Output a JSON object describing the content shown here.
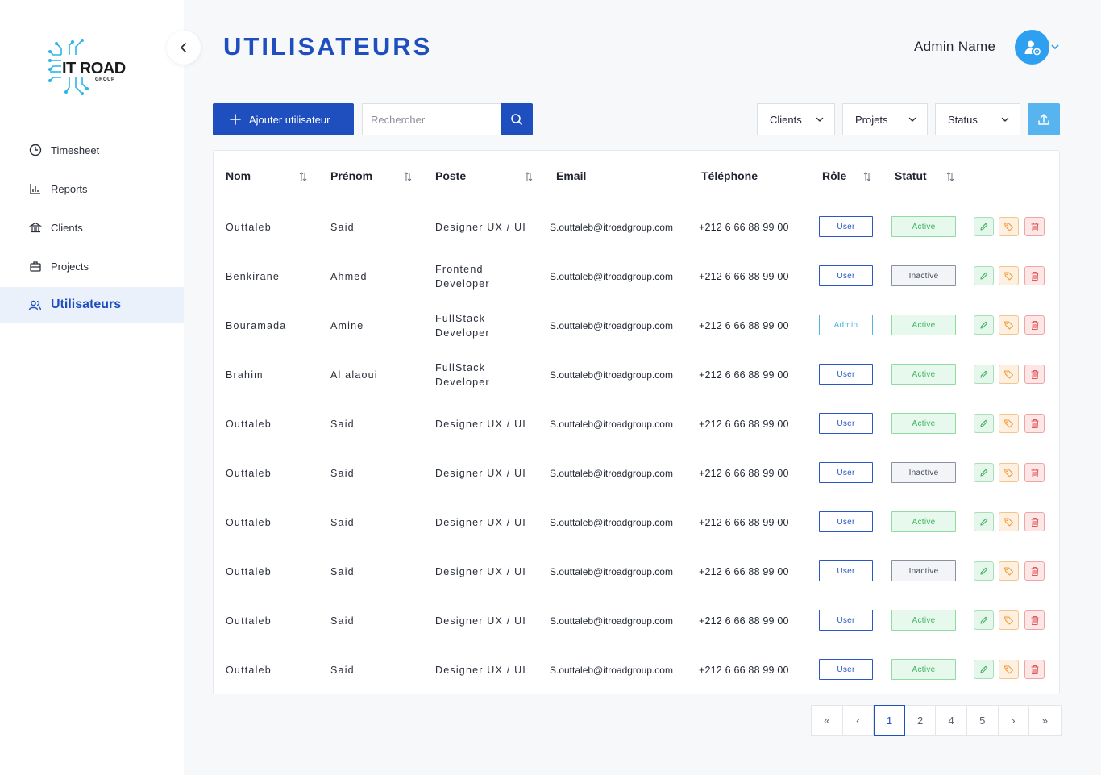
{
  "sidebar": {
    "logo": {
      "text": "IT ROAD",
      "sub": "GROUP"
    },
    "items": [
      {
        "label": "Timesheet",
        "icon": "clock-icon"
      },
      {
        "label": "Reports",
        "icon": "bar-chart-icon"
      },
      {
        "label": "Clients",
        "icon": "bank-icon"
      },
      {
        "label": "Projects",
        "icon": "briefcase-icon"
      },
      {
        "label": "Utilisateurs",
        "icon": "users-icon",
        "active": true
      }
    ]
  },
  "header": {
    "title": "UTILISATEURS",
    "admin_name": "Admin Name"
  },
  "toolbar": {
    "add_label": "Ajouter utilisateur",
    "search_placeholder": "Rechercher",
    "filters": [
      "Clients",
      "Projets",
      "Status"
    ]
  },
  "table": {
    "columns": {
      "nom": "Nom",
      "prenom": "Prénom",
      "poste": "Poste",
      "email": "Email",
      "telephone": "Téléphone",
      "role": "Rôle",
      "statut": "Statut"
    },
    "rows": [
      {
        "nom": "Outtaleb",
        "prenom": "Said",
        "poste": [
          "Designer UX / UI"
        ],
        "email": "S.outtaleb@itroadgroup.com",
        "tel": "+212 6 66 88 99 00",
        "role": "User",
        "statut": "Active"
      },
      {
        "nom": "Benkirane",
        "prenom": "Ahmed",
        "poste": [
          "Frontend",
          "Developer"
        ],
        "email": "S.outtaleb@itroadgroup.com",
        "tel": "+212 6 66 88 99 00",
        "role": "User",
        "statut": "Inactive"
      },
      {
        "nom": "Bouramada",
        "prenom": "Amine",
        "poste": [
          "FullStack",
          "Developer"
        ],
        "email": "S.outtaleb@itroadgroup.com",
        "tel": "+212 6 66 88 99 00",
        "role": "Admin",
        "statut": "Active"
      },
      {
        "nom": "Brahim",
        "prenom": "Al alaoui",
        "poste": [
          "FullStack",
          "Developer"
        ],
        "email": "S.outtaleb@itroadgroup.com",
        "tel": "+212 6 66 88 99 00",
        "role": "User",
        "statut": "Active"
      },
      {
        "nom": "Outtaleb",
        "prenom": "Said",
        "poste": [
          "Designer UX / UI"
        ],
        "email": "S.outtaleb@itroadgroup.com",
        "tel": "+212 6 66 88 99 00",
        "role": "User",
        "statut": "Active"
      },
      {
        "nom": "Outtaleb",
        "prenom": "Said",
        "poste": [
          "Designer UX / UI"
        ],
        "email": "S.outtaleb@itroadgroup.com",
        "tel": "+212 6 66 88 99 00",
        "role": "User",
        "statut": "Inactive"
      },
      {
        "nom": "Outtaleb",
        "prenom": "Said",
        "poste": [
          "Designer UX / UI"
        ],
        "email": "S.outtaleb@itroadgroup.com",
        "tel": "+212 6 66 88 99 00",
        "role": "User",
        "statut": "Active"
      },
      {
        "nom": "Outtaleb",
        "prenom": "Said",
        "poste": [
          "Designer UX / UI"
        ],
        "email": "S.outtaleb@itroadgroup.com",
        "tel": "+212 6 66 88 99 00",
        "role": "User",
        "statut": "Inactive"
      },
      {
        "nom": "Outtaleb",
        "prenom": "Said",
        "poste": [
          "Designer UX / UI"
        ],
        "email": "S.outtaleb@itroadgroup.com",
        "tel": "+212 6 66 88 99 00",
        "role": "User",
        "statut": "Active"
      },
      {
        "nom": "Outtaleb",
        "prenom": "Said",
        "poste": [
          "Designer UX / UI"
        ],
        "email": "S.outtaleb@itroadgroup.com",
        "tel": "+212 6 66 88 99 00",
        "role": "User",
        "statut": "Active"
      }
    ]
  },
  "pagination": {
    "first": "«",
    "prev": "‹",
    "pages": [
      "1",
      "2",
      "4",
      "5"
    ],
    "current": "1",
    "next": "›",
    "last": "»"
  },
  "colors": {
    "primary": "#1f4fbf",
    "accent": "#2f9ff0",
    "export": "#58b4ee",
    "active_green": "#3fb463",
    "danger": "#e05a5a",
    "warning": "#f29a3a"
  }
}
